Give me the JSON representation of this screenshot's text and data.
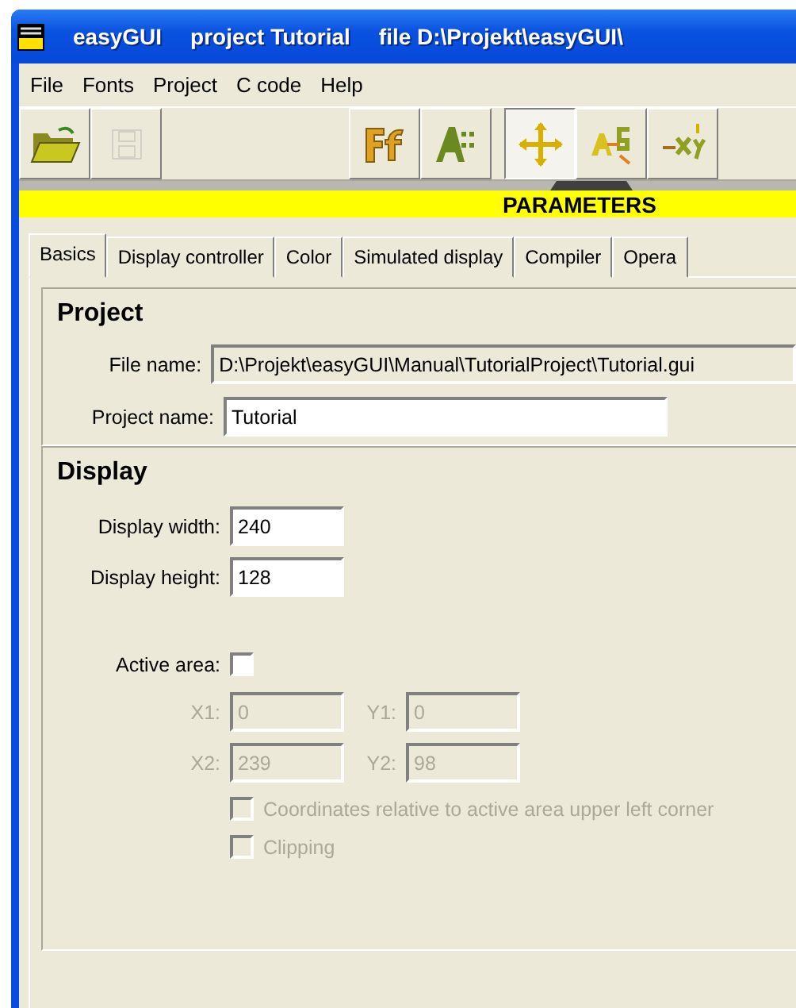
{
  "window": {
    "title_parts": [
      "easyGUI",
      "project Tutorial",
      "file D:\\Projekt\\easyGUI\\"
    ]
  },
  "menu": [
    "File",
    "Fonts",
    "Project",
    "C code",
    "Help"
  ],
  "toolbar": [
    {
      "kind": "open",
      "disabled": false,
      "pressed": false
    },
    {
      "kind": "save",
      "disabled": true,
      "pressed": false
    },
    {
      "kind": "fonts",
      "disabled": false,
      "pressed": false
    },
    {
      "kind": "chars",
      "disabled": false,
      "pressed": false
    },
    {
      "kind": "move",
      "disabled": false,
      "pressed": true
    },
    {
      "kind": "order",
      "disabled": false,
      "pressed": false
    },
    {
      "kind": "coords",
      "disabled": false,
      "pressed": false
    }
  ],
  "section_bar": "PARAMETERS",
  "tabs": [
    {
      "label": "Basics",
      "selected": true
    },
    {
      "label": "Display controller",
      "selected": false
    },
    {
      "label": "Color",
      "selected": false
    },
    {
      "label": "Simulated display",
      "selected": false
    },
    {
      "label": "Compiler",
      "selected": false
    },
    {
      "label": "Opera",
      "selected": false
    }
  ],
  "project": {
    "heading": "Project",
    "file_name": {
      "label": "File name:",
      "value": "D:\\Projekt\\easyGUI\\Manual\\TutorialProject\\Tutorial.gui",
      "readonly": true
    },
    "project_name": {
      "label": "Project name:",
      "value": "Tutorial",
      "readonly": false
    }
  },
  "display": {
    "heading": "Display",
    "width": {
      "label": "Display width:",
      "value": "240"
    },
    "height": {
      "label": "Display height:",
      "value": "128"
    },
    "active_area": {
      "label": "Active area:",
      "checked": false
    },
    "coords": [
      {
        "label": "X1:",
        "value": "0",
        "disabled": true
      },
      {
        "label": "Y1:",
        "value": "0",
        "disabled": true
      },
      {
        "label": "X2:",
        "value": "239",
        "disabled": true
      },
      {
        "label": "Y2:",
        "value": "98",
        "disabled": true
      }
    ],
    "options": [
      {
        "label": "Coordinates relative to active area upper left corner",
        "checked": false,
        "disabled": true
      },
      {
        "label": "Clipping",
        "checked": false,
        "disabled": true
      }
    ]
  }
}
